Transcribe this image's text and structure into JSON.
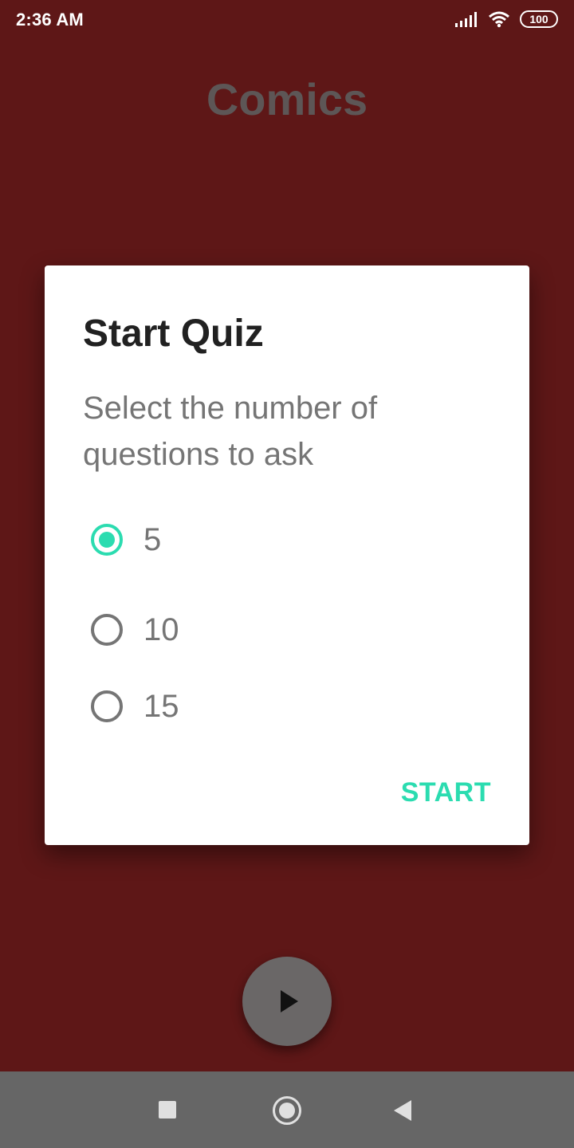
{
  "status_bar": {
    "time": "2:36 AM",
    "battery": "100",
    "icons": [
      "signal-icon",
      "wifi-icon",
      "battery-icon"
    ]
  },
  "app": {
    "title": "Comics"
  },
  "dialog": {
    "title": "Start Quiz",
    "message": "Select the number of questions to ask",
    "options": [
      {
        "label": "5",
        "selected": true
      },
      {
        "label": "10",
        "selected": false
      },
      {
        "label": "15",
        "selected": false
      }
    ],
    "start_label": "START"
  },
  "fab": {
    "icon": "play-icon"
  },
  "nav_bar": {
    "icons": [
      "recent-apps-icon",
      "home-icon",
      "back-icon"
    ]
  },
  "colors": {
    "background": "#5e1717",
    "accent": "#2bdcb0",
    "app_title": "#5d5656",
    "nav_bar": "#666666"
  }
}
